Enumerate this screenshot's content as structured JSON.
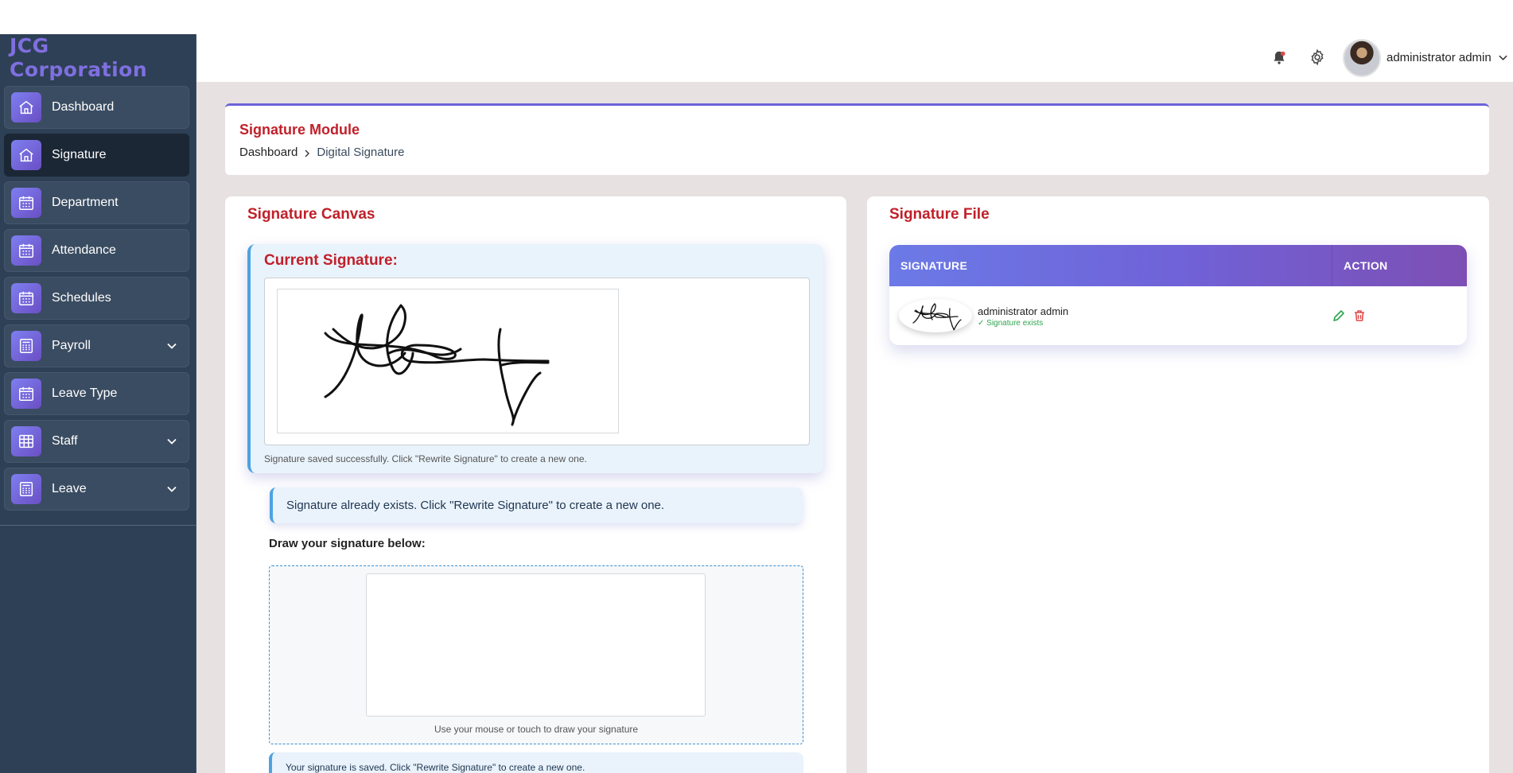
{
  "brand": {
    "name": "JCG Corporation"
  },
  "sidebar": {
    "items": [
      {
        "label": "Dashboard",
        "icon": "home-icon",
        "active": false,
        "expandable": false
      },
      {
        "label": "Signature",
        "icon": "home-icon",
        "active": true,
        "expandable": false
      },
      {
        "label": "Department",
        "icon": "calendar-icon",
        "active": false,
        "expandable": false
      },
      {
        "label": "Attendance",
        "icon": "calendar-icon",
        "active": false,
        "expandable": false
      },
      {
        "label": "Schedules",
        "icon": "calendar-icon",
        "active": false,
        "expandable": false
      },
      {
        "label": "Payroll",
        "icon": "calculator-icon",
        "active": false,
        "expandable": true
      },
      {
        "label": "Leave Type",
        "icon": "calendar-icon",
        "active": false,
        "expandable": false
      },
      {
        "label": "Staff",
        "icon": "table-icon",
        "active": false,
        "expandable": true
      },
      {
        "label": "Leave",
        "icon": "calculator-icon",
        "active": false,
        "expandable": true
      }
    ]
  },
  "topbar": {
    "icons": [
      "bell-icon",
      "gear-icon"
    ],
    "user_name": "administrator admin"
  },
  "header": {
    "title": "Signature Module",
    "breadcrumb_home": "Dashboard",
    "breadcrumb_current": "Digital Signature"
  },
  "canvas_panel": {
    "title": "Signature Canvas",
    "current_title": "Current Signature:",
    "saved_note": "Signature saved successfully. Click \"Rewrite Signature\" to create a new one.",
    "exists_alert": "Signature already exists. Click \"Rewrite Signature\" to create a new one.",
    "draw_label": "Draw your signature below:",
    "draw_hint": "Use your mouse or touch to draw your signature",
    "saved_alert": "Your signature is saved. Click \"Rewrite Signature\" to create a new one."
  },
  "file_panel": {
    "title": "Signature File",
    "columns": [
      "SIGNATURE",
      "ACTION"
    ],
    "rows": [
      {
        "name": "administrator admin",
        "status": "✓ Signature exists",
        "actions": [
          "edit-icon",
          "trash-icon"
        ]
      }
    ]
  },
  "colors": {
    "sidebar_bg": "#2e4055",
    "accent": "#6c63d9",
    "title_red": "#c0202a",
    "info_blue": "#4da3e0",
    "success_green": "#2ea44f",
    "danger_red": "#e04848"
  }
}
